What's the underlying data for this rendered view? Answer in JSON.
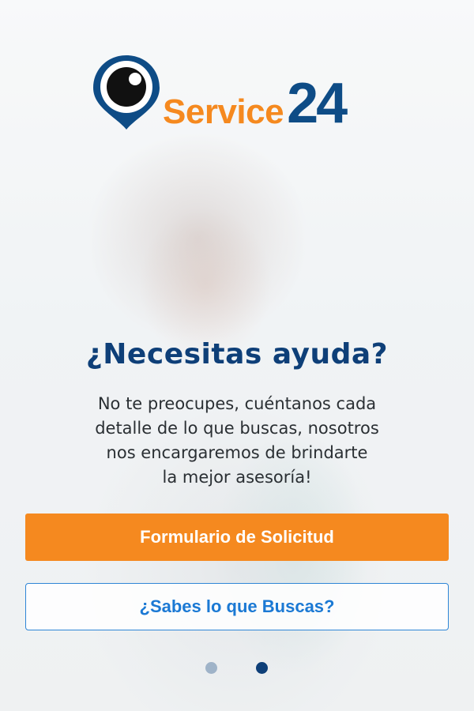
{
  "colors": {
    "brand_orange": "#f5891f",
    "brand_blue": "#0e4c86",
    "headline_blue": "#0e3f78",
    "link_blue": "#1b79d4",
    "dot_inactive": "#9fb3c8",
    "dot_active": "#0e3f78"
  },
  "logo": {
    "icon": "location-pin-eye-icon",
    "service": "Service",
    "number": "24"
  },
  "hero": {
    "title": "¿Necesitas ayuda?",
    "lines": [
      "No te preocupes, cuéntanos cada",
      "detalle de lo que buscas, nosotros",
      "nos encargaremos de brindarte",
      "la mejor asesoría!"
    ]
  },
  "buttons": {
    "primary_label": "Formulario de Solicitud",
    "secondary_label": "¿Sabes lo que Buscas?"
  },
  "pager": {
    "count": 2,
    "active_index": 2
  }
}
